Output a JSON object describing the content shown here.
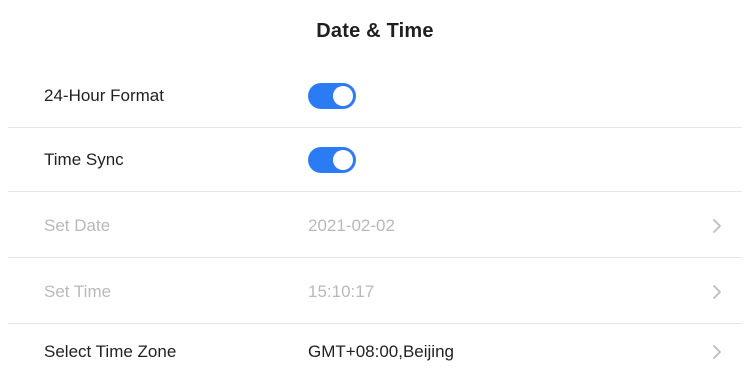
{
  "header": {
    "title": "Date & Time"
  },
  "rows": [
    {
      "label": "24-Hour Format",
      "toggle_on": true
    },
    {
      "label": "Time Sync",
      "toggle_on": true
    },
    {
      "label": "Set Date",
      "value": "2021-02-02",
      "disabled": true,
      "icon": "chevron-right-icon"
    },
    {
      "label": "Set Time",
      "value": "15:10:17",
      "disabled": true,
      "icon": "chevron-right-icon"
    },
    {
      "label": "Select Time Zone",
      "value": "GMT+08:00,Beijing",
      "disabled": false,
      "icon": "chevron-right-icon"
    }
  ],
  "colors": {
    "accent": "#2b7cf3",
    "disabled_text": "#b9b9b9",
    "divider": "#e6e6e6"
  }
}
